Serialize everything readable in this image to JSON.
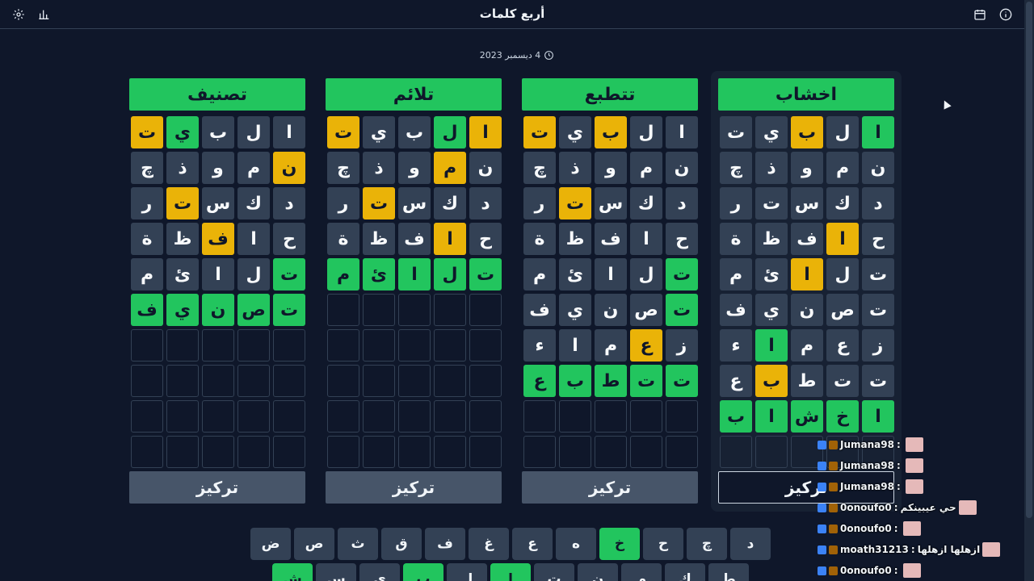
{
  "header": {
    "title": "أربع كلمات",
    "icons": [
      "settings-icon",
      "stats-icon",
      "calendar-icon",
      "info-icon"
    ]
  },
  "date": "4 ديسمبر 2023",
  "colors": {
    "correct": "#22c55e",
    "present": "#eab308",
    "absent": "#334155",
    "background": "#0f172a"
  },
  "boards": [
    {
      "word": "اخشاب",
      "focus_label": "تركيز",
      "rows": [
        [
          [
            "ا",
            "c"
          ],
          [
            "ل",
            "g"
          ],
          [
            "ب",
            "p"
          ],
          [
            "ي",
            "g"
          ],
          [
            "ت",
            "g"
          ]
        ],
        [
          [
            "ن",
            "g"
          ],
          [
            "م",
            "g"
          ],
          [
            "و",
            "g"
          ],
          [
            "ذ",
            "g"
          ],
          [
            "چ",
            "g"
          ]
        ],
        [
          [
            "د",
            "g"
          ],
          [
            "ك",
            "g"
          ],
          [
            "س",
            "g"
          ],
          [
            "ت",
            "g"
          ],
          [
            "ر",
            "g"
          ]
        ],
        [
          [
            "ح",
            "g"
          ],
          [
            "ا",
            "p"
          ],
          [
            "ف",
            "g"
          ],
          [
            "ظ",
            "g"
          ],
          [
            "ة",
            "g"
          ]
        ],
        [
          [
            "ت",
            "g"
          ],
          [
            "ل",
            "g"
          ],
          [
            "ا",
            "p"
          ],
          [
            "ئ",
            "g"
          ],
          [
            "م",
            "g"
          ]
        ],
        [
          [
            "ت",
            "g"
          ],
          [
            "ص",
            "g"
          ],
          [
            "ن",
            "g"
          ],
          [
            "ي",
            "g"
          ],
          [
            "ف",
            "g"
          ]
        ],
        [
          [
            "ز",
            "g"
          ],
          [
            "ع",
            "g"
          ],
          [
            "م",
            "g"
          ],
          [
            "ا",
            "c"
          ],
          [
            "ء",
            "g"
          ]
        ],
        [
          [
            "ت",
            "g"
          ],
          [
            "ت",
            "g"
          ],
          [
            "ط",
            "g"
          ],
          [
            "ب",
            "p"
          ],
          [
            "ع",
            "g"
          ]
        ],
        [
          [
            "ا",
            "c"
          ],
          [
            "خ",
            "c"
          ],
          [
            "ش",
            "c"
          ],
          [
            "ا",
            "c"
          ],
          [
            "ب",
            "c"
          ]
        ],
        [
          [
            "",
            ""
          ],
          [
            "",
            ""
          ],
          [
            "",
            ""
          ],
          [
            "",
            ""
          ],
          [
            "",
            ""
          ]
        ]
      ]
    },
    {
      "word": "تتطبع",
      "focus_label": "تركيز",
      "rows": [
        [
          [
            "ا",
            "g"
          ],
          [
            "ل",
            "g"
          ],
          [
            "ب",
            "p"
          ],
          [
            "ي",
            "g"
          ],
          [
            "ت",
            "p"
          ]
        ],
        [
          [
            "ن",
            "g"
          ],
          [
            "م",
            "g"
          ],
          [
            "و",
            "g"
          ],
          [
            "ذ",
            "g"
          ],
          [
            "چ",
            "g"
          ]
        ],
        [
          [
            "د",
            "g"
          ],
          [
            "ك",
            "g"
          ],
          [
            "س",
            "g"
          ],
          [
            "ت",
            "p"
          ],
          [
            "ر",
            "g"
          ]
        ],
        [
          [
            "ح",
            "g"
          ],
          [
            "ا",
            "g"
          ],
          [
            "ف",
            "g"
          ],
          [
            "ظ",
            "g"
          ],
          [
            "ة",
            "g"
          ]
        ],
        [
          [
            "ت",
            "c"
          ],
          [
            "ل",
            "g"
          ],
          [
            "ا",
            "g"
          ],
          [
            "ئ",
            "g"
          ],
          [
            "م",
            "g"
          ]
        ],
        [
          [
            "ت",
            "c"
          ],
          [
            "ص",
            "g"
          ],
          [
            "ن",
            "g"
          ],
          [
            "ي",
            "g"
          ],
          [
            "ف",
            "g"
          ]
        ],
        [
          [
            "ز",
            "g"
          ],
          [
            "ع",
            "p"
          ],
          [
            "م",
            "g"
          ],
          [
            "ا",
            "g"
          ],
          [
            "ء",
            "g"
          ]
        ],
        [
          [
            "ت",
            "c"
          ],
          [
            "ت",
            "c"
          ],
          [
            "ط",
            "c"
          ],
          [
            "ب",
            "c"
          ],
          [
            "ع",
            "c"
          ]
        ],
        [
          [
            "",
            ""
          ],
          [
            "",
            ""
          ],
          [
            "",
            ""
          ],
          [
            "",
            ""
          ],
          [
            "",
            ""
          ]
        ],
        [
          [
            "",
            ""
          ],
          [
            "",
            ""
          ],
          [
            "",
            ""
          ],
          [
            "",
            ""
          ],
          [
            "",
            ""
          ]
        ]
      ]
    },
    {
      "word": "تلائم",
      "focus_label": "تركيز",
      "rows": [
        [
          [
            "ا",
            "p"
          ],
          [
            "ل",
            "c"
          ],
          [
            "ب",
            "g"
          ],
          [
            "ي",
            "g"
          ],
          [
            "ت",
            "p"
          ]
        ],
        [
          [
            "ن",
            "g"
          ],
          [
            "م",
            "p"
          ],
          [
            "و",
            "g"
          ],
          [
            "ذ",
            "g"
          ],
          [
            "چ",
            "g"
          ]
        ],
        [
          [
            "د",
            "g"
          ],
          [
            "ك",
            "g"
          ],
          [
            "س",
            "g"
          ],
          [
            "ت",
            "p"
          ],
          [
            "ر",
            "g"
          ]
        ],
        [
          [
            "ح",
            "g"
          ],
          [
            "ا",
            "p"
          ],
          [
            "ف",
            "g"
          ],
          [
            "ظ",
            "g"
          ],
          [
            "ة",
            "g"
          ]
        ],
        [
          [
            "ت",
            "c"
          ],
          [
            "ل",
            "c"
          ],
          [
            "ا",
            "c"
          ],
          [
            "ئ",
            "c"
          ],
          [
            "م",
            "c"
          ]
        ],
        [
          [
            "",
            ""
          ],
          [
            "",
            ""
          ],
          [
            "",
            ""
          ],
          [
            "",
            ""
          ],
          [
            "",
            ""
          ]
        ],
        [
          [
            "",
            ""
          ],
          [
            "",
            ""
          ],
          [
            "",
            ""
          ],
          [
            "",
            ""
          ],
          [
            "",
            ""
          ]
        ],
        [
          [
            "",
            ""
          ],
          [
            "",
            ""
          ],
          [
            "",
            ""
          ],
          [
            "",
            ""
          ],
          [
            "",
            ""
          ]
        ],
        [
          [
            "",
            ""
          ],
          [
            "",
            ""
          ],
          [
            "",
            ""
          ],
          [
            "",
            ""
          ],
          [
            "",
            ""
          ]
        ],
        [
          [
            "",
            ""
          ],
          [
            "",
            ""
          ],
          [
            "",
            ""
          ],
          [
            "",
            ""
          ],
          [
            "",
            ""
          ]
        ]
      ]
    },
    {
      "word": "تصنيف",
      "focus_label": "تركيز",
      "rows": [
        [
          [
            "ا",
            "g"
          ],
          [
            "ل",
            "g"
          ],
          [
            "ب",
            "g"
          ],
          [
            "ي",
            "c"
          ],
          [
            "ت",
            "p"
          ]
        ],
        [
          [
            "ن",
            "p"
          ],
          [
            "م",
            "g"
          ],
          [
            "و",
            "g"
          ],
          [
            "ذ",
            "g"
          ],
          [
            "چ",
            "g"
          ]
        ],
        [
          [
            "د",
            "g"
          ],
          [
            "ك",
            "g"
          ],
          [
            "س",
            "g"
          ],
          [
            "ت",
            "p"
          ],
          [
            "ر",
            "g"
          ]
        ],
        [
          [
            "ح",
            "g"
          ],
          [
            "ا",
            "g"
          ],
          [
            "ف",
            "p"
          ],
          [
            "ظ",
            "g"
          ],
          [
            "ة",
            "g"
          ]
        ],
        [
          [
            "ت",
            "c"
          ],
          [
            "ل",
            "g"
          ],
          [
            "ا",
            "g"
          ],
          [
            "ئ",
            "g"
          ],
          [
            "م",
            "g"
          ]
        ],
        [
          [
            "ت",
            "c"
          ],
          [
            "ص",
            "c"
          ],
          [
            "ن",
            "c"
          ],
          [
            "ي",
            "c"
          ],
          [
            "ف",
            "c"
          ]
        ],
        [
          [
            "",
            ""
          ],
          [
            "",
            ""
          ],
          [
            "",
            ""
          ],
          [
            "",
            ""
          ],
          [
            "",
            ""
          ]
        ],
        [
          [
            "",
            ""
          ],
          [
            "",
            ""
          ],
          [
            "",
            ""
          ],
          [
            "",
            ""
          ],
          [
            "",
            ""
          ]
        ],
        [
          [
            "",
            ""
          ],
          [
            "",
            ""
          ],
          [
            "",
            ""
          ],
          [
            "",
            ""
          ],
          [
            "",
            ""
          ]
        ],
        [
          [
            "",
            ""
          ],
          [
            "",
            ""
          ],
          [
            "",
            ""
          ],
          [
            "",
            ""
          ],
          [
            "",
            ""
          ]
        ]
      ]
    }
  ],
  "keyboard": {
    "row1": [
      [
        "د",
        "g"
      ],
      [
        "چ",
        "g"
      ],
      [
        "ح",
        "g"
      ],
      [
        "خ",
        "c"
      ],
      [
        "ه",
        "g"
      ],
      [
        "ع",
        "g"
      ],
      [
        "غ",
        "g"
      ],
      [
        "ف",
        "g"
      ],
      [
        "ق",
        "g"
      ],
      [
        "ث",
        "g"
      ],
      [
        "ص",
        "g"
      ],
      [
        "ض",
        "g"
      ]
    ],
    "row2": [
      [
        "ط",
        "g"
      ],
      [
        "ك",
        "g"
      ],
      [
        "م",
        "g"
      ],
      [
        "ن",
        "g"
      ],
      [
        "ت",
        "g"
      ],
      [
        "ا",
        "c"
      ],
      [
        "ل",
        "g"
      ],
      [
        "ب",
        "c"
      ],
      [
        "ي",
        "g"
      ],
      [
        "س",
        "g"
      ],
      [
        "ش",
        "c"
      ]
    ]
  },
  "chat": [
    {
      "user": "Jumana98",
      "text": ""
    },
    {
      "user": "Jumana98",
      "text": ""
    },
    {
      "user": "Jumana98",
      "text": ""
    },
    {
      "user": "0onoufo0",
      "text": "حي عيبينكم"
    },
    {
      "user": "0onoufo0",
      "text": ""
    },
    {
      "user": "moath31213",
      "text": "ازهلها ازهلها"
    },
    {
      "user": "0onoufo0",
      "text": ""
    }
  ]
}
